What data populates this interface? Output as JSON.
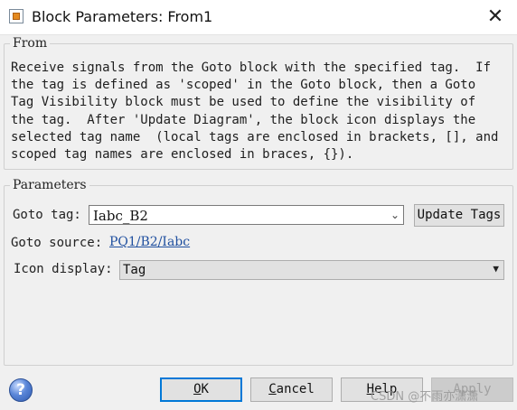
{
  "window": {
    "title": "Block Parameters: From1",
    "close_glyph": "✕"
  },
  "from_section": {
    "legend": "From",
    "description_lines": [
      "Receive signals from the Goto block with the specified tag.  If",
      "the tag is defined as 'scoped' in the Goto block, then a Goto",
      "Tag Visibility block must be used to define the visibility of",
      "the tag.  After 'Update Diagram', the block icon displays the",
      "selected tag name  (local tags are enclosed in brackets, [], and",
      "scoped tag names are enclosed in braces, {})."
    ]
  },
  "parameters_section": {
    "legend": "Parameters",
    "goto_tag_label": "Goto tag:",
    "goto_tag_value": "Iabc_B2",
    "update_tags_label": "Update Tags",
    "goto_source_label": "Goto source:",
    "goto_source_link": "PQ1/B2/Iabc",
    "icon_display_label": "Icon display:",
    "icon_display_value": "Tag"
  },
  "buttons": {
    "ok_first": "O",
    "ok_rest": "K",
    "cancel_first": "C",
    "cancel_rest": "ancel",
    "help_first": "H",
    "help_rest": "elp",
    "apply_label": "Apply"
  },
  "watermark": "CSDN @不雨亦潇潇",
  "icons": {
    "app": "simulink-block-icon",
    "help": "help-question-icon",
    "dropdown": "chevron-down-icon"
  }
}
